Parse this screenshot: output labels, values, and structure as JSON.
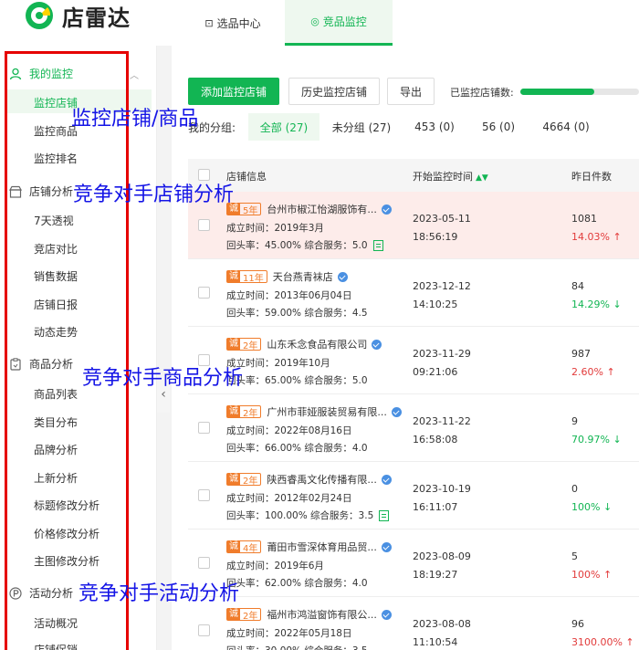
{
  "brand": {
    "name": "店雷达"
  },
  "nav": {
    "tabs": [
      {
        "label": "选品中心",
        "icon": "box-icon"
      },
      {
        "label": "竞品监控",
        "icon": "location-icon",
        "active": true
      }
    ]
  },
  "sidebar": {
    "sections": [
      {
        "label": "我的监控",
        "icon": "user-icon",
        "items": [
          "监控店铺",
          "监控商品",
          "监控排名"
        ]
      },
      {
        "label": "店铺分析",
        "icon": "store-icon",
        "items": [
          "7天透视",
          "竞店对比",
          "销售数据",
          "店铺日报",
          "动态走势"
        ]
      },
      {
        "label": "商品分析",
        "icon": "clipboard-icon",
        "items": [
          "商品列表",
          "类目分布",
          "品牌分析",
          "上新分析",
          "标题修改分析",
          "价格修改分析",
          "主图修改分析"
        ]
      },
      {
        "label": "活动分析",
        "icon": "p-circle-icon",
        "items": [
          "活动概况",
          "店铺促销"
        ]
      }
    ],
    "active_item": "监控店铺"
  },
  "toolbar": {
    "add_label": "添加监控店铺",
    "history_label": "历史监控店铺",
    "export_label": "导出",
    "count_label": "已监控店铺数:",
    "count_fraction": 0.62
  },
  "groups": {
    "label": "我的分组:",
    "tabs": [
      "全部 (27)",
      "未分组 (27)",
      "453 (0)",
      "56 (0)",
      "4664 (0)"
    ]
  },
  "table": {
    "headers": {
      "shop": "店铺信息",
      "start": "开始监控时间",
      "sales": "昨日件数"
    },
    "rows": [
      {
        "years": "5年",
        "name": "台州市椒江怡湖服饰有...",
        "founded": "成立时间：2019年3月",
        "stats": "回头率：45.00%   综合服务：5.0",
        "note": true,
        "date": "2023-05-11",
        "time": "18:56:19",
        "sales": "1081",
        "change": "14.03% ↑",
        "dir": "up",
        "highlight": true
      },
      {
        "years": "11年",
        "name": "天台燕青袜店",
        "founded": "成立时间：2013年06月04日",
        "stats": "回头率：59.00%   综合服务：4.5",
        "note": false,
        "date": "2023-12-12",
        "time": "14:10:25",
        "sales": "84",
        "change": "14.29% ↓",
        "dir": "down"
      },
      {
        "years": "2年",
        "name": "山东禾念食品有限公司",
        "founded": "成立时间：2019年10月",
        "stats": "回头率：65.00%   综合服务：5.0",
        "note": false,
        "date": "2023-11-29",
        "time": "09:21:06",
        "sales": "987",
        "change": "2.60% ↑",
        "dir": "up"
      },
      {
        "years": "2年",
        "name": "广州市菲娅服装贸易有限...",
        "founded": "成立时间：2022年08月16日",
        "stats": "回头率：66.00%   综合服务：4.0",
        "note": false,
        "date": "2023-11-22",
        "time": "16:58:08",
        "sales": "9",
        "change": "70.97% ↓",
        "dir": "down"
      },
      {
        "years": "2年",
        "name": "陕西睿禹文化传播有限...",
        "founded": "成立时间：2012年02月24日",
        "stats": "回头率：100.00%   综合服务：3.5",
        "note": true,
        "date": "2023-10-19",
        "time": "16:11:07",
        "sales": "0",
        "change": "100% ↓",
        "dir": "down"
      },
      {
        "years": "4年",
        "name": "莆田市雪深体育用品贸...",
        "founded": "成立时间：2019年6月",
        "stats": "回头率：62.00%   综合服务：4.0",
        "note": false,
        "date": "2023-08-09",
        "time": "18:19:27",
        "sales": "5",
        "change": "100% ↑",
        "dir": "up"
      },
      {
        "years": "2年",
        "name": "福州市鸿溢窗饰有限公...",
        "founded": "成立时间：2022年05月18日",
        "stats": "回头率：30.00%   综合服务：3.5",
        "note": false,
        "date": "2023-08-08",
        "time": "11:10:54",
        "sales": "96",
        "change": "3100.00% ↑",
        "dir": "up"
      }
    ]
  },
  "annotations": [
    "监控店铺/商品",
    "竞争对手店铺分析",
    "竞争对手商品分析",
    "竞争对手活动分析"
  ],
  "colors": {
    "brand_green": "#12b553",
    "annotation_blue": "#1515e6",
    "annotation_red": "#e60000",
    "up_red": "#e23b3b"
  }
}
